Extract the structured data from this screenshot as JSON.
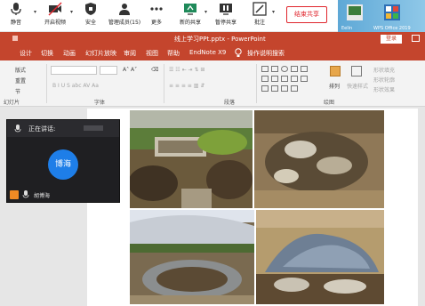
{
  "meeting_toolbar": {
    "mute_label": "静音",
    "video_label": "开启视频",
    "security_label": "安全",
    "manage_members_label": "管理成员(15)",
    "more_label": "更多",
    "new_share_label": "新的共享",
    "pause_share_label": "暂停共享",
    "annotate_label": "批注",
    "end_share_label": "结束共享"
  },
  "desktop_icons": [
    "Eelin",
    "WPS Office 2019"
  ],
  "powerpoint": {
    "title": "线上学习PPt.pptx - PowerPoint",
    "login_label": "登录",
    "tabs": [
      "设计",
      "切换",
      "动画",
      "幻灯片放映",
      "审阅",
      "视图",
      "帮助",
      "EndNote X9",
      "操作说明搜索"
    ],
    "ribbon": {
      "new_slide_label": "版式",
      "reset_label": "重置",
      "section_label": "节",
      "group_slides": "幻灯片",
      "group_font": "字体",
      "group_paragraph": "段落",
      "group_drawing": "绘图",
      "arrange_label": "排列",
      "quick_styles_label": "快速样式",
      "shape_fill_label": "形状填充",
      "shape_outline_label": "形状轮廓",
      "shape_effects_label": "形状效果"
    }
  },
  "video_panel": {
    "speaking_label": "正在讲话:",
    "avatar_text": "博海",
    "user_name": "胡博海"
  },
  "colors": {
    "ppt_accent": "#c4452d",
    "end_share": "#e0262d",
    "avatar": "#1e7ee8"
  }
}
